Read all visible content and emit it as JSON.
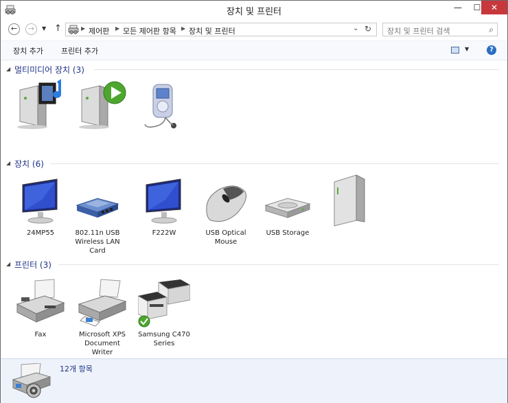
{
  "window": {
    "title": "장치 및 프린터",
    "minimize_glyph": "—",
    "maximize_glyph": "☐",
    "close_glyph": "✕"
  },
  "address": {
    "crumbs": [
      "제어판",
      "모든 제어판 항목",
      "장치 및 프린터"
    ],
    "search_placeholder": "장치 및 프린터 검색"
  },
  "commands": {
    "add_device": "장치 추가",
    "add_printer": "프린터 추가",
    "help_glyph": "?"
  },
  "groups": {
    "multimedia": {
      "title": "멀티미디어 장치 (3)",
      "items": [
        {
          "label": ""
        },
        {
          "label": ""
        },
        {
          "label": ""
        }
      ]
    },
    "devices": {
      "title": "장치 (6)",
      "items": [
        {
          "label": "24MP55"
        },
        {
          "label": "802.11n USB Wireless LAN Card"
        },
        {
          "label": "F222W"
        },
        {
          "label": "USB Optical Mouse"
        },
        {
          "label": "USB Storage"
        },
        {
          "label": ""
        }
      ]
    },
    "printers": {
      "title": "프린터 (3)",
      "items": [
        {
          "label": "Fax"
        },
        {
          "label": "Microsoft XPS Document Writer"
        },
        {
          "label": "Samsung C470 Series",
          "is_default": true
        }
      ]
    }
  },
  "status": {
    "count_text": "12개 항목"
  },
  "colors": {
    "group_title": "#1e3287",
    "close_button": "#c7383c",
    "status_bg": "#eef3fb",
    "accent_blue": "#2b6cc4"
  }
}
